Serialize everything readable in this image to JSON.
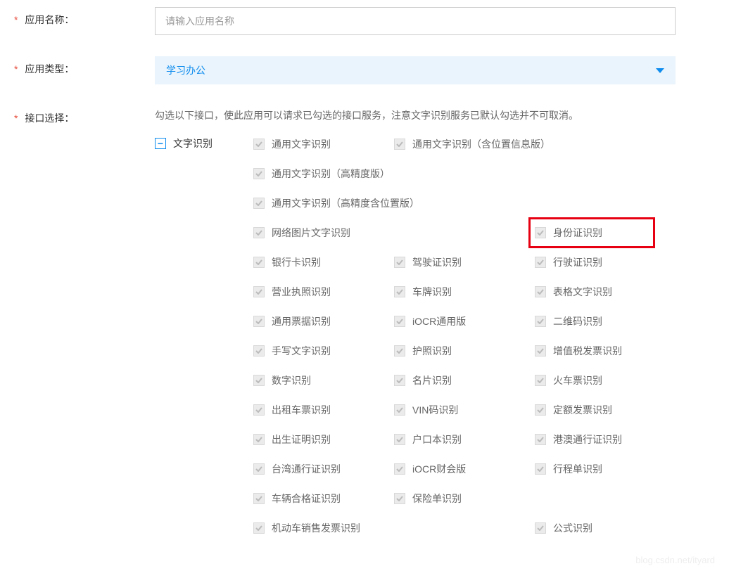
{
  "fields": {
    "appName": {
      "label": "应用名称：",
      "placeholder": "请输入应用名称"
    },
    "appType": {
      "label": "应用类型：",
      "value": "学习办公"
    },
    "apiSelect": {
      "label": "接口选择：",
      "help": "勾选以下接口，使此应用可以请求已勾选的接口服务，注意文字识别服务已默认勾选并不可取消。",
      "category": "文字识别"
    }
  },
  "apis": {
    "r0a": "通用文字识别",
    "r0b": "通用文字识别（含位置信息版）",
    "r1a": "通用文字识别（高精度版）",
    "r2a": "通用文字识别（高精度含位置版）",
    "r3a": "网络图片文字识别",
    "r3c": "身份证识别",
    "r4a": "银行卡识别",
    "r4b": "驾驶证识别",
    "r4c": "行驶证识别",
    "r5a": "营业执照识别",
    "r5b": "车牌识别",
    "r5c": "表格文字识别",
    "r6a": "通用票据识别",
    "r6b": "iOCR通用版",
    "r6c": "二维码识别",
    "r7a": "手写文字识别",
    "r7b": "护照识别",
    "r7c": "增值税发票识别",
    "r8a": "数字识别",
    "r8b": "名片识别",
    "r8c": "火车票识别",
    "r9a": "出租车票识别",
    "r9b": "VIN码识别",
    "r9c": "定额发票识别",
    "r10a": "出生证明识别",
    "r10b": "户口本识别",
    "r10c": "港澳通行证识别",
    "r11a": "台湾通行证识别",
    "r11b": "iOCR财会版",
    "r11c": "行程单识别",
    "r12a": "车辆合格证识别",
    "r12b": "保险单识别",
    "r13a": "机动车销售发票识别",
    "r13c": "公式识别"
  },
  "watermark": "blog.csdn.net/ityard"
}
